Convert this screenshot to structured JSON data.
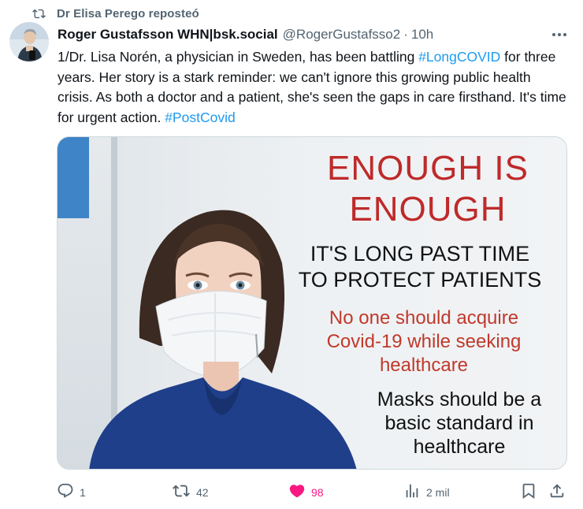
{
  "repost": {
    "text": "Dr Elisa Perego reposteó",
    "icon": "repost-icon"
  },
  "author": {
    "name": "Roger Gustafsson WHN|bsk.social",
    "handle": "@RogerGustafsso2",
    "separator": "·",
    "time": "10h"
  },
  "tweet": {
    "text_part1": "1/Dr. Lisa Norén, a physician in Sweden, has been battling ",
    "hashtag1": "#LongCOVID",
    "text_part2": " for three years. Her story is a stark reminder: we can't ignore this growing public health crisis. As both a doctor and a patient, she's seen the gaps in care firsthand. It's time for urgent action. ",
    "hashtag2": "#PostCovid"
  },
  "media": {
    "headline_line1": "ENOUGH IS",
    "headline_line2": "ENOUGH",
    "sub_line1": "IT'S LONG PAST TIME",
    "sub_line2": "TO PROTECT PATIENTS",
    "red_line1": "No one should acquire",
    "red_line2": "Covid-19 while seeking",
    "red_line3": "healthcare",
    "black_line1": "Masks should be a",
    "black_line2": "basic standard in",
    "black_line3": "healthcare"
  },
  "actions": {
    "replies": "1",
    "reposts": "42",
    "likes": "98",
    "views": "2 mil"
  },
  "colors": {
    "accent": "#1d9bf0",
    "like": "#f91880",
    "muted": "#536471",
    "poster_red": "#bf2a2a"
  }
}
